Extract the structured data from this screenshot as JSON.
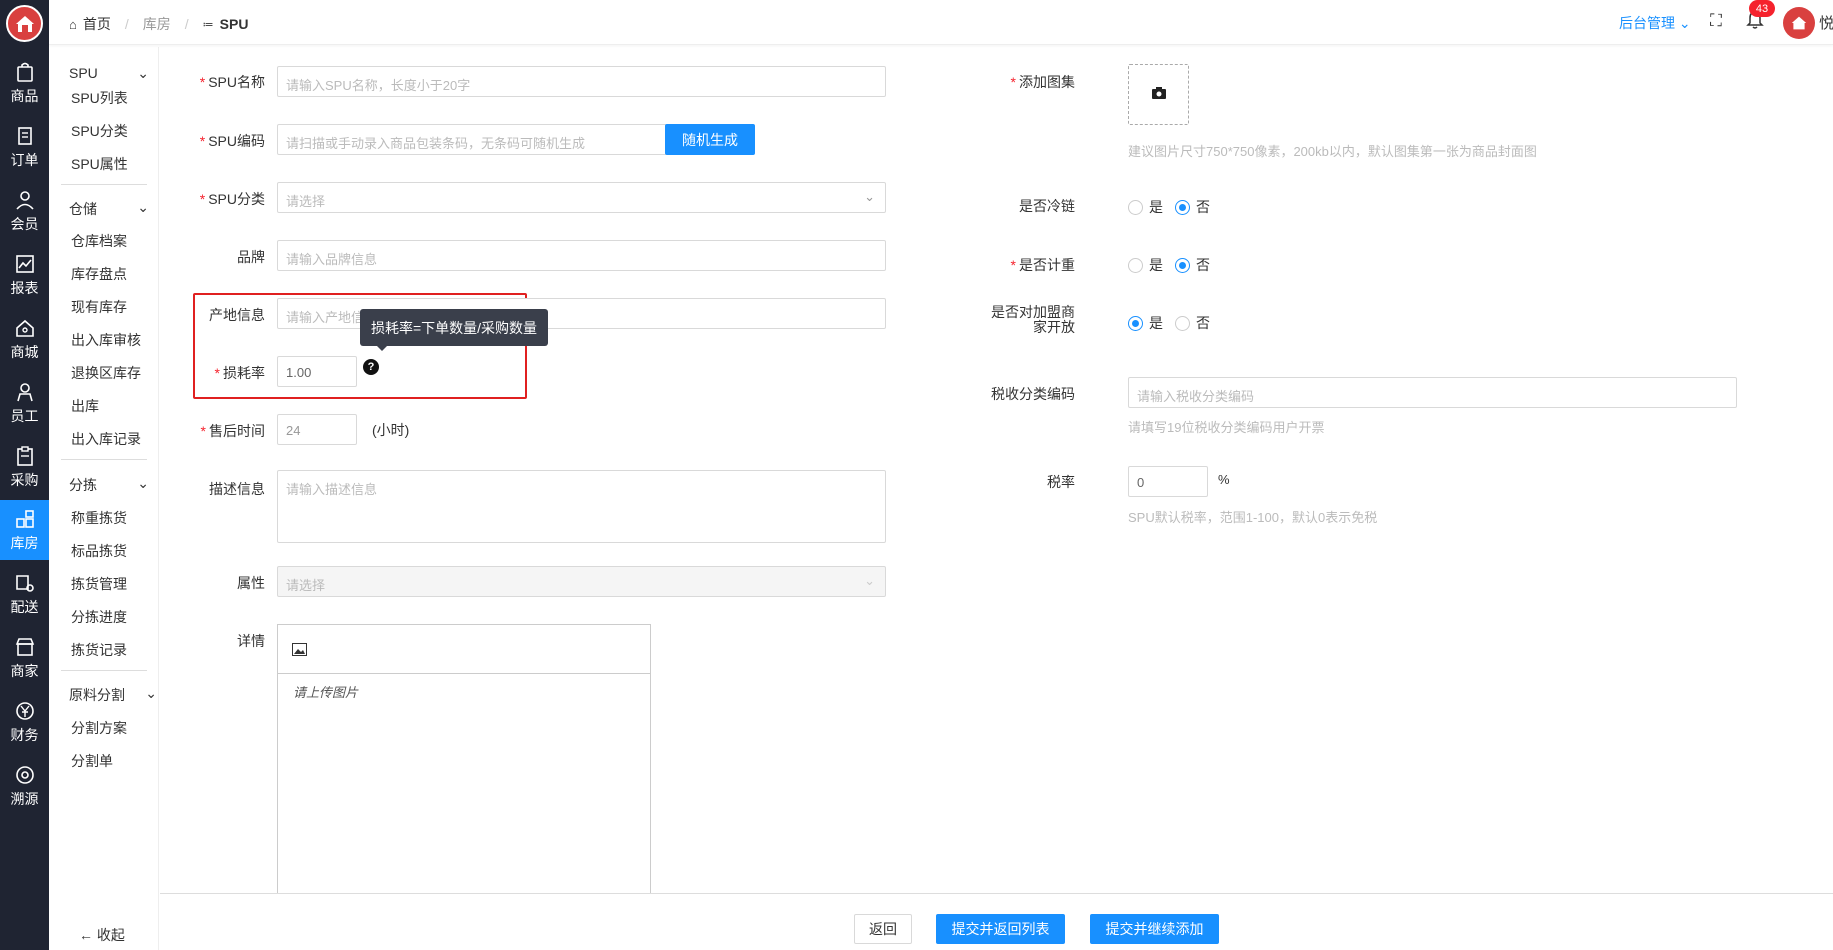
{
  "nav": [
    {
      "label": "商品",
      "icon": "shopping-bag-icon"
    },
    {
      "label": "订单",
      "icon": "document-icon"
    },
    {
      "label": "会员",
      "icon": "user-icon"
    },
    {
      "label": "报表",
      "icon": "chart-icon"
    },
    {
      "label": "商城",
      "icon": "home-icon"
    },
    {
      "label": "员工",
      "icon": "staff-icon"
    },
    {
      "label": "采购",
      "icon": "clipboard-icon"
    },
    {
      "label": "库房",
      "icon": "grid-icon"
    },
    {
      "label": "配送",
      "icon": "delivery-icon"
    },
    {
      "label": "商家",
      "icon": "store-icon"
    },
    {
      "label": "财务",
      "icon": "yen-icon"
    },
    {
      "label": "溯源",
      "icon": "trace-icon"
    }
  ],
  "submenu": {
    "g1": "SPU",
    "g1_items": [
      "SPU列表",
      "SPU分类",
      "SPU属性"
    ],
    "g2": "仓储",
    "g2_items": [
      "仓库档案",
      "库存盘点",
      "现有库存",
      "出入库审核",
      "退换区库存",
      "出库",
      "出入库记录"
    ],
    "g3": "分拣",
    "g3_items": [
      "称重拣货",
      "标品拣货",
      "拣货管理",
      "分拣进度",
      "拣货记录"
    ],
    "g4": "原料分割",
    "g4_items": [
      "分割方案",
      "分割单"
    ],
    "collapse": "收起"
  },
  "breadcrumb": {
    "home": "首页",
    "sep": "/",
    "second": "库房",
    "current": "SPU"
  },
  "topbar": {
    "admin": "后台管理",
    "badge": "43",
    "user": "悦"
  },
  "form": {
    "spu_name": {
      "label": "SPU名称",
      "placeholder": "请输入SPU名称，长度小于20字"
    },
    "spu_code": {
      "label": "SPU编码",
      "placeholder": "请扫描或手动录入商品包装条码，无条码可随机生成",
      "button": "随机生成"
    },
    "spu_cat": {
      "label": "SPU分类",
      "placeholder": "请选择"
    },
    "brand": {
      "label": "品牌",
      "placeholder": "请输入品牌信息"
    },
    "origin": {
      "label": "产地信息",
      "placeholder": "请输入产地信息"
    },
    "loss": {
      "label": "损耗率",
      "value": "1.00",
      "tooltip": "损耗率=下单数量/采购数量"
    },
    "after_sale": {
      "label": "售后时间",
      "value": "24",
      "unit": "(小时)"
    },
    "desc": {
      "label": "描述信息",
      "placeholder": "请输入描述信息"
    },
    "attr": {
      "label": "属性",
      "placeholder": "请选择"
    },
    "detail": {
      "label": "详情",
      "placeholder": "请上传图片"
    },
    "gallery": {
      "label": "添加图集",
      "hint": "建议图片尺寸750*750像素，200kb以内，默认图集第一张为商品封面图"
    },
    "cold": {
      "label": "是否冷链",
      "yes": "是",
      "no": "否"
    },
    "weigh": {
      "label": "是否计重",
      "yes": "是",
      "no": "否"
    },
    "franchise": {
      "label1": "是否对加盟商",
      "label2": "家开放",
      "yes": "是",
      "no": "否"
    },
    "tax_code": {
      "label": "税收分类编码",
      "placeholder": "请输入税收分类编码",
      "hint": "请填写19位税收分类编码用户开票"
    },
    "tax_rate": {
      "label": "税率",
      "value": "0",
      "unit": "%",
      "hint": "SPU默认税率，范围1-100，默认0表示免税"
    }
  },
  "footer": {
    "back": "返回",
    "submit_list": "提交并返回列表",
    "submit_continue": "提交并继续添加"
  }
}
